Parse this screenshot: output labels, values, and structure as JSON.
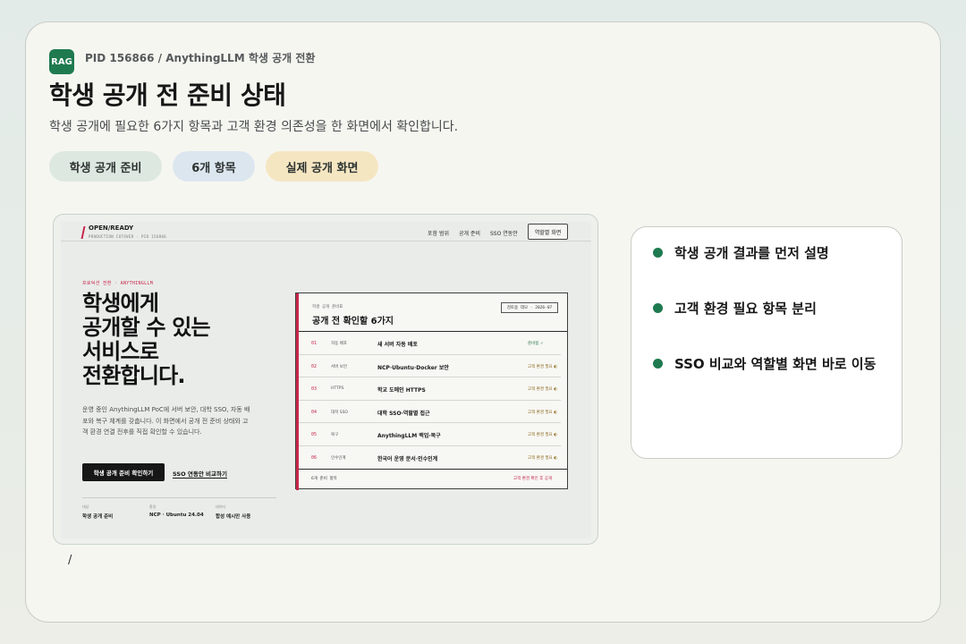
{
  "header": {
    "badge": "RAG",
    "breadcrumb": "PID 156866 / AnythingLLM 학생 공개 전환",
    "title": "학생 공개 전 준비 상태",
    "subtitle": "학생 공개에 필요한 6가지 항목과 고객 환경 의존성을 한 화면에서 확인합니다."
  },
  "chips": [
    "학생 공개 준비",
    "6개 항목",
    "실제 공개 화면"
  ],
  "preview": {
    "brand": "OPEN/READY",
    "brand_sub": "PRODUCTION CUTOVER · PID 156866",
    "nav": [
      "포함 범위",
      "공개 준비",
      "SSO 연동안"
    ],
    "nav_button": "역할별 화면",
    "eyebrow": "프로덕션 전환 · ANYTHINGLLM",
    "hero_lines": [
      "학생에게",
      "공개할 수 있는",
      "서비스로",
      "전환합니다."
    ],
    "description": "운영 중인 AnythingLLM PoC에 서버 보안, 대학 SSO, 자동 배포와 복구 체계를 갖춥니다. 이 화면에서 공개 전 준비 상태와 고객 환경 연결 전후를 직접 확인할 수 있습니다.",
    "cta": "학생 공개 준비 확인하기",
    "link": "SSO 연동안 비교하기",
    "meta": [
      {
        "label": "대상",
        "value": "학생 공개 준비"
      },
      {
        "label": "환경",
        "value": "NCP · Ubuntu 24.04"
      },
      {
        "label": "데이터",
        "value": "합성 예시만 사용"
      }
    ],
    "panel": {
      "eyebrow": "학생 공개 준비표",
      "title": "공개 전 확인할 6가지",
      "date": "검토용 데모 · 2026-07",
      "rows": [
        {
          "num": "01",
          "cat": "자동 배포",
          "name": "새 서버 자동 배포",
          "status": "준비됨 ✓"
        },
        {
          "num": "02",
          "cat": "서버 보안",
          "name": "NCP·Ubuntu·Docker 보안",
          "status": "고객 환경 필요 ◐"
        },
        {
          "num": "03",
          "cat": "HTTPS",
          "name": "학교 도메인 HTTPS",
          "status": "고객 환경 필요 ◐"
        },
        {
          "num": "04",
          "cat": "대학 SSO",
          "name": "대학 SSO·역할별 접근",
          "status": "고객 환경 필요 ◐"
        },
        {
          "num": "05",
          "cat": "복구",
          "name": "AnythingLLM 백업·복구",
          "status": "고객 환경 필요 ◐"
        },
        {
          "num": "06",
          "cat": "인수인계",
          "name": "한국어 운영 문서·인수인계",
          "status": "고객 환경 필요 ◐"
        }
      ],
      "foot_left": "6개 준비 항목",
      "foot_right": "고객 환경 확인 후 공개"
    }
  },
  "slash": "/",
  "checklist": [
    "학생 공개 결과를 먼저 설명",
    "고객 환경 필요 항목 분리",
    "SSO 비교와 역할별 화면 바로 이동"
  ],
  "colors": {
    "accent_green": "#1f7a4f",
    "accent_red": "#c7274a",
    "chip_green": "#dde8e1",
    "chip_blue": "#dce6ef",
    "chip_yellow": "#f5e6c2"
  }
}
